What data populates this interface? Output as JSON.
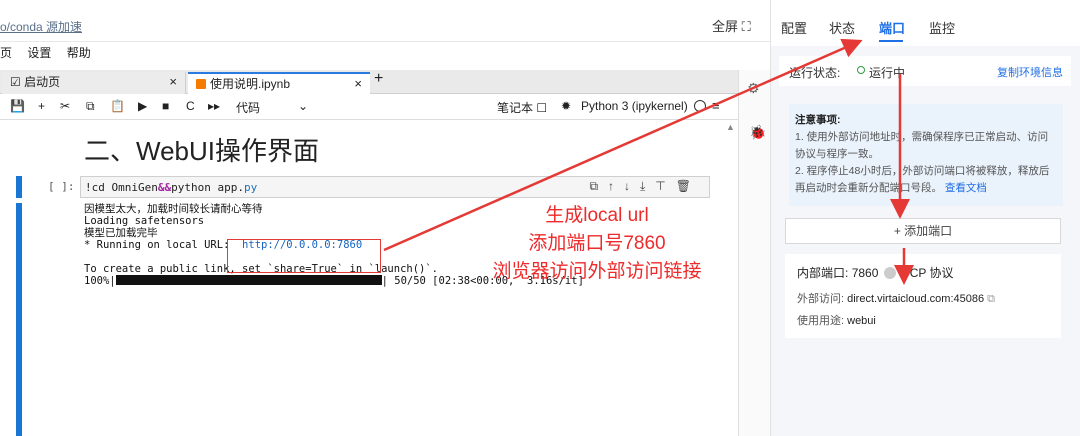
{
  "topbar": {
    "path": "o/conda 源加速",
    "fullscreen": "全屏 ⛶"
  },
  "menu": [
    "页",
    "设置",
    "帮助"
  ],
  "tabs": [
    {
      "label": "☑ 启动页",
      "close": "×"
    },
    {
      "label": "使用说明.ipynb",
      "close": "×"
    }
  ],
  "tab_add": "+",
  "toolbar": {
    "icons": [
      "💾",
      "+",
      "✂",
      "⧉",
      "📋",
      "▶",
      "■",
      "C",
      "▸▸"
    ],
    "cell_type": "代码",
    "cell_type_chevron": "⌄",
    "notebook_label": "笔记本 ☐",
    "gear": "✹",
    "kernel": "Python 3 (ipykernel)",
    "menu_icon": "≡"
  },
  "notebook": {
    "heading": "二、WebUI操作界面",
    "prompt": "[ ]:",
    "code_prefix": "!cd OmniGen",
    "code_amp": "&&",
    "code_mid": "python app.",
    "code_ext": "py",
    "cell_tools": "⧉↑↓⤓⊤🗑",
    "output": {
      "line1": "因模型太大，加载时间较长请耐心等待",
      "line2": "Loading safetensors",
      "line3": "模型已加载完毕",
      "line4_prefix": "* Running on local URL:  ",
      "url": "http://0.0.0.0:7860",
      "line5": "To create a public link, set `share=True` in `launch()`.",
      "progress_prefix": "100%|",
      "progress_suffix": "| 50/50 [02:38<00:00,  3.16s/it]",
      "progress_value": 1.0
    }
  },
  "annotation": {
    "line1": "生成local url",
    "line2": "添加端口号7860",
    "line3": "浏览器访问外部访问链接"
  },
  "side_icons": {
    "gear": "⚙",
    "bug": "🐞"
  },
  "right_panel": {
    "tabs": [
      "配置",
      "状态",
      "端口",
      "监控"
    ],
    "active_tab": "端口",
    "status_label": "运行状态:",
    "status_value": "运行中",
    "copy_env": "复制环境信息",
    "notice_title": "注意事项:",
    "notice_1": "1. 使用外部访问地址时，需确保程序已正常启动、访问协议与程序一致。",
    "notice_2": "2. 程序停止48小时后，外部访问端口将被释放，释放后再启动时会重新分配端口号段。",
    "notice_link": "查看文档",
    "add_port": "+ 添加端口",
    "internal_port_label": "内部端口:",
    "internal_port": "7860",
    "protocol": "TCP 协议",
    "external_label": "外部访问:",
    "external_url": "direct.virtaicloud.com:45086",
    "copy_icon": "⧉",
    "usage_label": "使用用途:",
    "usage_value": "webui"
  },
  "colors": {
    "accent": "#1f6fe5",
    "annotation": "#e53935",
    "status_green": "#2e9b43",
    "cell_bar": "#1976d2"
  }
}
